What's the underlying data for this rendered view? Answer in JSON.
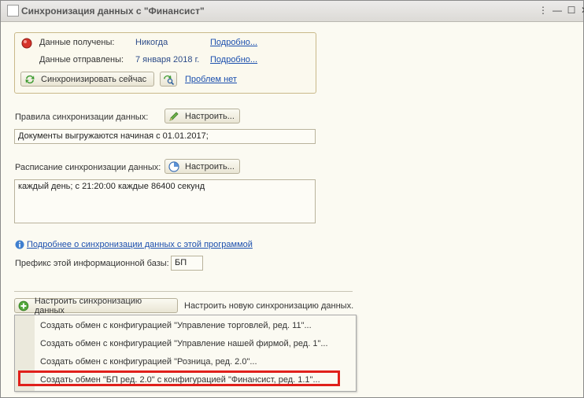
{
  "window": {
    "title": "Синхронизация данных с \"Финансист\"",
    "controls": [
      "⋮",
      "—",
      "☐",
      "✕"
    ]
  },
  "status": {
    "received_label": "Данные получены:",
    "received_value": "Никогда",
    "received_link": "Подробно...",
    "sent_label": "Данные отправлены:",
    "sent_value": "7 января 2018 г.",
    "sent_link": "Подробно...",
    "sync_button": "Синхронизировать сейчас",
    "problems_link": "Проблем нет"
  },
  "rules": {
    "label": "Правила синхронизации данных:",
    "button": "Настроить...",
    "value": "Документы выгружаются начиная с 01.01.2017;"
  },
  "schedule": {
    "label": "Расписание синхронизации данных:",
    "button": "Настроить...",
    "value": "каждый день; с 21:20:00 каждые 86400 секунд"
  },
  "more_link": "Подробнее о синхронизации данных с этой программой",
  "prefix": {
    "label": "Префикс этой информационной базы:",
    "value": "БП"
  },
  "setup": {
    "button": "Настроить синхронизацию данных",
    "hint": "Настроить новую синхронизацию данных."
  },
  "menu": {
    "items": [
      "Создать обмен с конфигурацией \"Управление торговлей, ред. 11\"...",
      "Создать обмен с конфигурацией \"Управление нашей фирмой, ред. 1\"...",
      "Создать обмен с конфигурацией \"Розница, ред. 2.0\"...",
      "Создать обмен \"БП ред. 2.0\" с конфигурацией \"Финансист, ред. 1.1\"..."
    ]
  },
  "colors": {
    "highlight": "#e0201b",
    "link": "#1b4fae",
    "group_border": "#c9b98a"
  }
}
